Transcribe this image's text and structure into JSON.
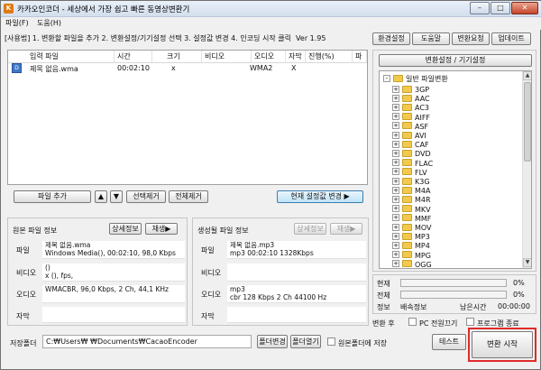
{
  "window": {
    "title": "카카오인코더 - 세상에서 가장 쉽고 빠른 동영상변환기",
    "app_icon_glyph": "K",
    "minimize_glyph": "–",
    "maximize_glyph": "□",
    "close_glyph": "✕"
  },
  "menu": {
    "file": "파일(F)",
    "help": "도움(H)"
  },
  "instructions": "[사용법] 1. 변환할 파일을 추가  2. 변환설정/기기설정 선택  3. 설정값 변경  4. 인코딩 시작 클릭",
  "version": "Ver 1.95",
  "top_buttons": {
    "env": "환경설정",
    "help": "도움말",
    "request": "변환요청",
    "update": "업데이트"
  },
  "file_list": {
    "columns": [
      "입력 파일",
      "시간",
      "크기",
      "비디오",
      "오디오",
      "자막",
      "진행(%)",
      "파"
    ],
    "rows": [
      {
        "name": "제목 없음.wma",
        "time": "00:02:10",
        "size": "x",
        "video": "",
        "audio": "WMA2",
        "subtitle": "X",
        "progress": "",
        "extra": ""
      }
    ],
    "row_icon_glyph": "D"
  },
  "list_buttons": {
    "add": "파일 추가",
    "up": "▲",
    "down": "▼",
    "remove_selected": "선택제거",
    "remove_all": "전체제거",
    "change_settings": "현재 설정값 변경 ▶"
  },
  "source_info": {
    "title": "원본 파일 정보",
    "detail_button": "상세정보",
    "play_button": "재생▶",
    "rows": [
      {
        "label": "파일",
        "lines": [
          "제목 없음.wma",
          "Windows Media(), 00:02:10, 98,0 Kbps"
        ]
      },
      {
        "label": "비디오",
        "lines": [
          "()",
          "x (),  fps,"
        ]
      },
      {
        "label": "오디오",
        "lines": [
          "WMACBR, 96,0 Kbps, 2 Ch, 44,1 KHz"
        ]
      },
      {
        "label": "자막",
        "lines": [
          ""
        ]
      }
    ]
  },
  "output_info": {
    "title": "생성될 파일 정보",
    "detail_button": "상세정보",
    "play_button": "재생▶",
    "rows": [
      {
        "label": "파일",
        "lines": [
          "제목 없음.mp3",
          "mp3  00:02:10  1328Kbps"
        ]
      },
      {
        "label": "비디오",
        "lines": [
          ""
        ]
      },
      {
        "label": "오디오",
        "lines": [
          "mp3",
          "cbr    128 Kbps  2 Ch   44100 Hz"
        ]
      },
      {
        "label": "자막",
        "lines": [
          ""
        ]
      }
    ]
  },
  "settings_panel": {
    "header_button": "변환설정 / 기기설정",
    "root": "일반 파일변환",
    "root_expand_glyph": "-",
    "item_expand_glyph": "+",
    "items": [
      "3GP",
      "AAC",
      "AC3",
      "AIFF",
      "ASF",
      "AVI",
      "CAF",
      "DVD",
      "FLAC",
      "FLV",
      "K3G",
      "M4A",
      "M4R",
      "MKV",
      "MMF",
      "MOV",
      "MP3",
      "MP4",
      "MPG",
      "OGG"
    ]
  },
  "progress": {
    "current_label": "현재",
    "current_value": 0,
    "current_text": "0%",
    "total_label": "전체",
    "total_value": 0,
    "total_text": "0%",
    "info_label": "정보",
    "speed_label": "배속정보",
    "remaining_label": "남은시간",
    "remaining_value": "00:00:00"
  },
  "after_convert": {
    "label": "변환 후",
    "pc_shutdown": "PC 전원끄기",
    "pc_shutdown_checked": false,
    "exit_program": "프로그램 종료",
    "exit_program_checked": false
  },
  "save_folder": {
    "label": "저장폴더",
    "path": "C:₩Users₩     ₩Documents₩CacaoEncoder",
    "change_button": "폴더변경",
    "open_button": "폴더열기",
    "save_to_source": "원본폴더에 저장",
    "save_to_source_checked": false
  },
  "bottom_buttons": {
    "test": "테스트",
    "start": "변환 시작"
  },
  "colors": {
    "highlight_border": "#e02a2a",
    "folder": "#f2c94c",
    "progress_bg": "#f4f4f4"
  }
}
